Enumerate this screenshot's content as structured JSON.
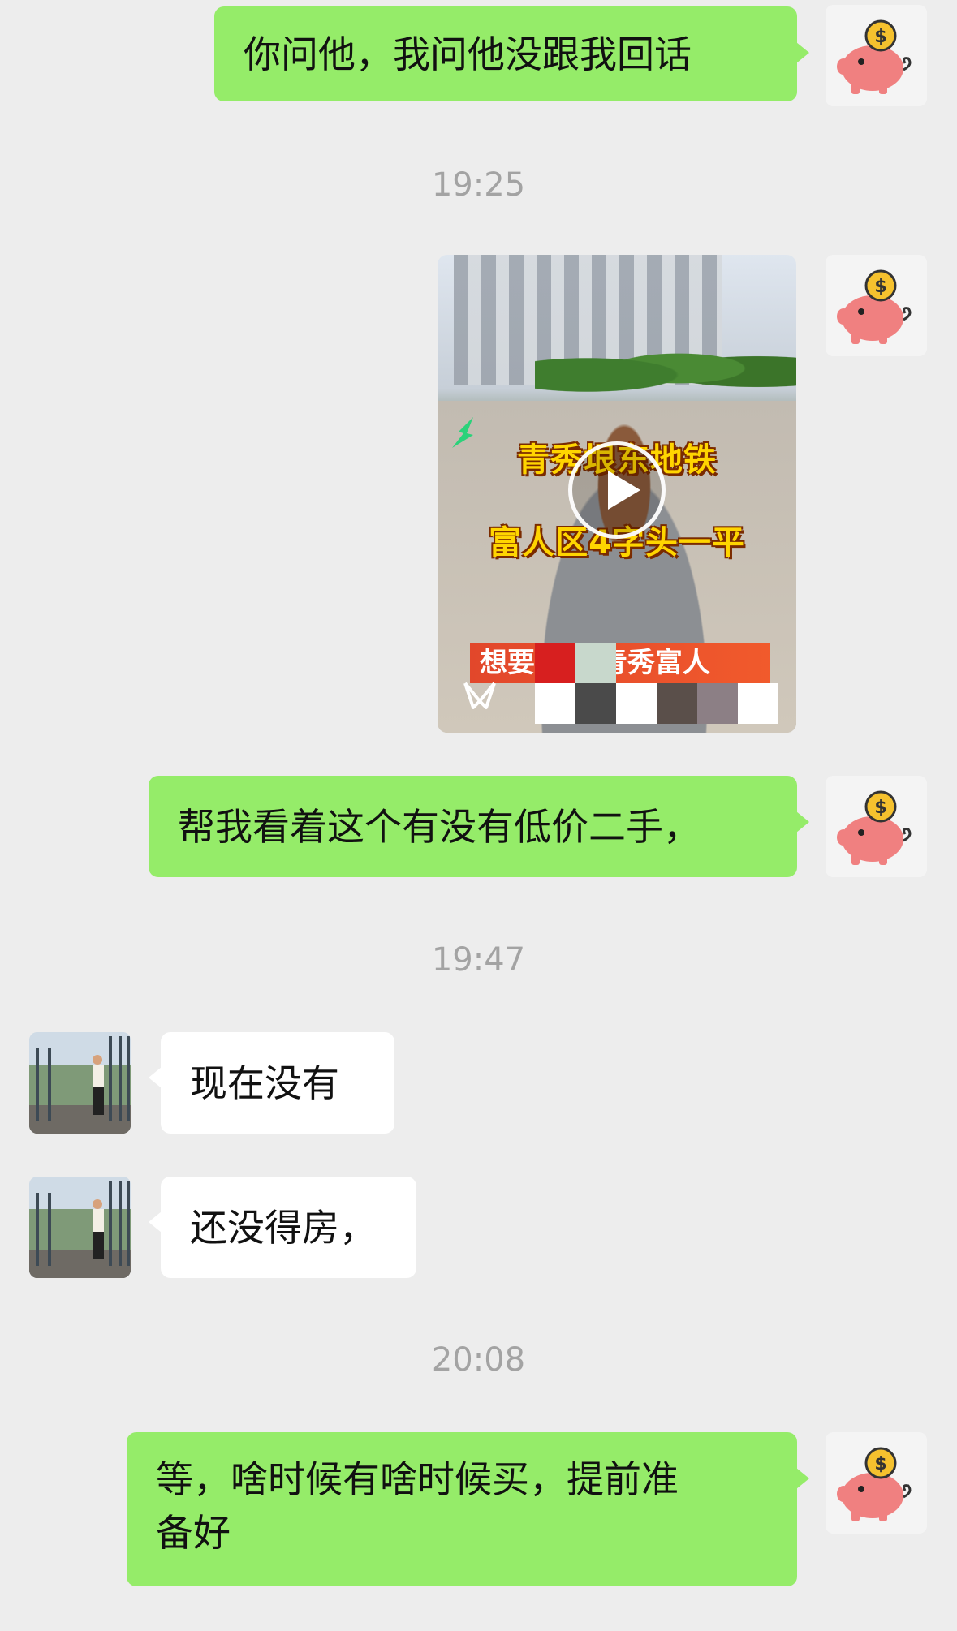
{
  "messages": [
    {
      "text": "你问他，我问他没跟我回话"
    },
    {
      "timestamp": "19:25"
    },
    {
      "video": {
        "title_line1": "青秀垠东地铁",
        "title_line2": "富人区4字头一平",
        "caption": "想要 安家青秀富人"
      }
    },
    {
      "text": "帮我看着这个有没有低价二手，"
    },
    {
      "timestamp": "19:47"
    },
    {
      "text": "现在没有"
    },
    {
      "text": "还没得房，"
    },
    {
      "timestamp": "20:08"
    },
    {
      "text_line1": "等，啥时候有啥时候买，提前准",
      "text_line2": "备好"
    }
  ],
  "colors": {
    "background": "#ededed",
    "my_bubble": "#95ec69",
    "other_bubble": "#ffffff",
    "timestamp": "#a3a3a3"
  },
  "icons": {
    "my_avatar": "piggy-bank-icon",
    "play": "play-icon",
    "video_brand": "butterfly-icon"
  }
}
